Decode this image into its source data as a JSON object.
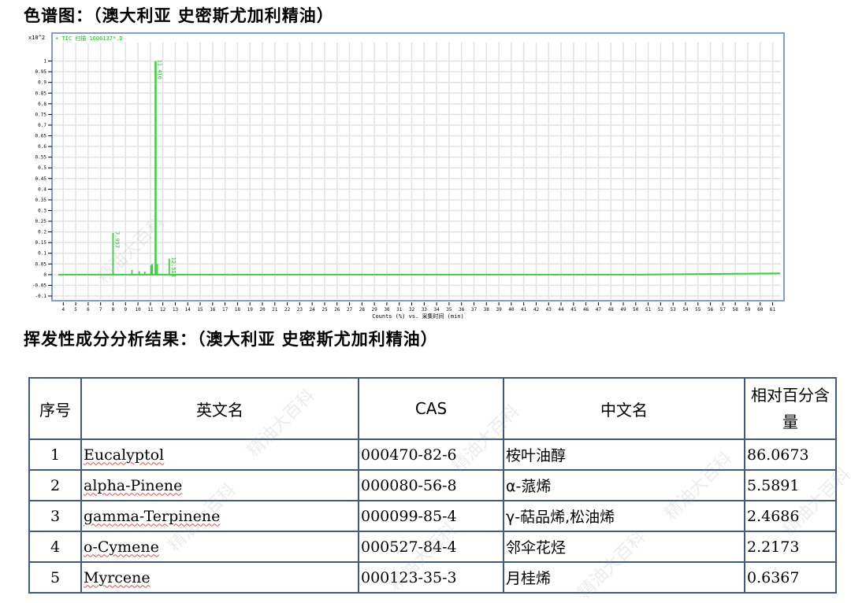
{
  "headings": {
    "chromatogram": "色谱图：（澳大利亚 史密斯尤加利精油）",
    "results": "挥发性成分分析结果：（澳大利亚 史密斯尤加利精油）"
  },
  "chart_data": {
    "type": "line",
    "title": "",
    "legend": "+ TIC 扫描 1606137*.D",
    "legend_position": "top-left",
    "xlabel": "Counts (%) vs. 采集时间 (min)",
    "ylabel": "",
    "y_multiplier": "x10^2",
    "xlim": [
      3.6,
      61.6
    ],
    "ylim": [
      -0.1,
      1.05
    ],
    "x_ticks": [
      4,
      5,
      6,
      7,
      8,
      9,
      10,
      11,
      12,
      13,
      14,
      15,
      16,
      17,
      18,
      19,
      20,
      21,
      22,
      23,
      24,
      25,
      26,
      27,
      28,
      29,
      30,
      31,
      32,
      33,
      34,
      35,
      36,
      37,
      38,
      39,
      40,
      41,
      42,
      43,
      44,
      45,
      46,
      47,
      48,
      49,
      50,
      51,
      52,
      53,
      54,
      55,
      56,
      57,
      58,
      59,
      60,
      61
    ],
    "y_ticks": [
      -0.1,
      -0.05,
      0,
      0.05,
      0.1,
      0.15,
      0.2,
      0.25,
      0.3,
      0.35,
      0.4,
      0.45,
      0.5,
      0.55,
      0.6,
      0.65,
      0.7,
      0.75,
      0.8,
      0.85,
      0.9,
      0.95,
      1
    ],
    "y_tick_labels": [
      "-0.1",
      "-0.05",
      "0",
      "0.05",
      "0.1",
      "0.15",
      "0.2",
      "0.25",
      "0.3",
      "0.35",
      "0.4",
      "0.45",
      "0.5",
      "0.55",
      "0.6",
      "0.65",
      "0.7",
      "0.75",
      "0.8",
      "0.85",
      "0.9",
      "0.95",
      "1"
    ],
    "grid": true,
    "color": "#3ccf3c",
    "baseline": 0,
    "peaks": [
      {
        "rt": 7.997,
        "height": 0.195,
        "label": "7.997"
      },
      {
        "rt": 9.52,
        "height": 0.022,
        "label": ""
      },
      {
        "rt": 10.1,
        "height": 0.016,
        "label": ""
      },
      {
        "rt": 10.55,
        "height": 0.014,
        "label": ""
      },
      {
        "rt": 11.05,
        "height": 0.045,
        "label": ""
      },
      {
        "rt": 11.15,
        "height": 0.05,
        "label": ""
      },
      {
        "rt": 11.416,
        "height": 1.0,
        "label": "11.416"
      },
      {
        "rt": 11.55,
        "height": 0.05,
        "label": ""
      },
      {
        "rt": 12.513,
        "height": 0.075,
        "label": "12.513"
      },
      {
        "rt": 17.2,
        "height": 0.004,
        "label": ""
      },
      {
        "rt": 17.6,
        "height": 0.004,
        "label": ""
      }
    ],
    "drift": [
      [
        3.6,
        0.0
      ],
      [
        50,
        0.0
      ],
      [
        61.6,
        0.006
      ]
    ]
  },
  "table": {
    "headers": [
      "序号",
      "英文名",
      "CAS",
      "中文名",
      "相对百分含量"
    ],
    "rows": [
      {
        "idx": "1",
        "en": "Eucalyptol",
        "cas": "000470-82-6",
        "cn": "桉叶油醇",
        "pct": "86.0673"
      },
      {
        "idx": "2",
        "en": "alpha-Pinene",
        "cas": "000080-56-8",
        "cn": "α-蒎烯",
        "pct": "5.5891"
      },
      {
        "idx": "3",
        "en": "gamma-Terpinene",
        "cas": "000099-85-4",
        "cn": "γ-萜品烯,松油烯",
        "pct": "2.4686"
      },
      {
        "idx": "4",
        "en": "o-Cymene",
        "cas": "000527-84-4",
        "cn": "邻伞花烃",
        "pct": "2.2173"
      },
      {
        "idx": "5",
        "en": "Myrcene",
        "cas": "000123-35-3",
        "cn": "月桂烯",
        "pct": "0.6367"
      }
    ]
  },
  "watermark": "精油大百科"
}
